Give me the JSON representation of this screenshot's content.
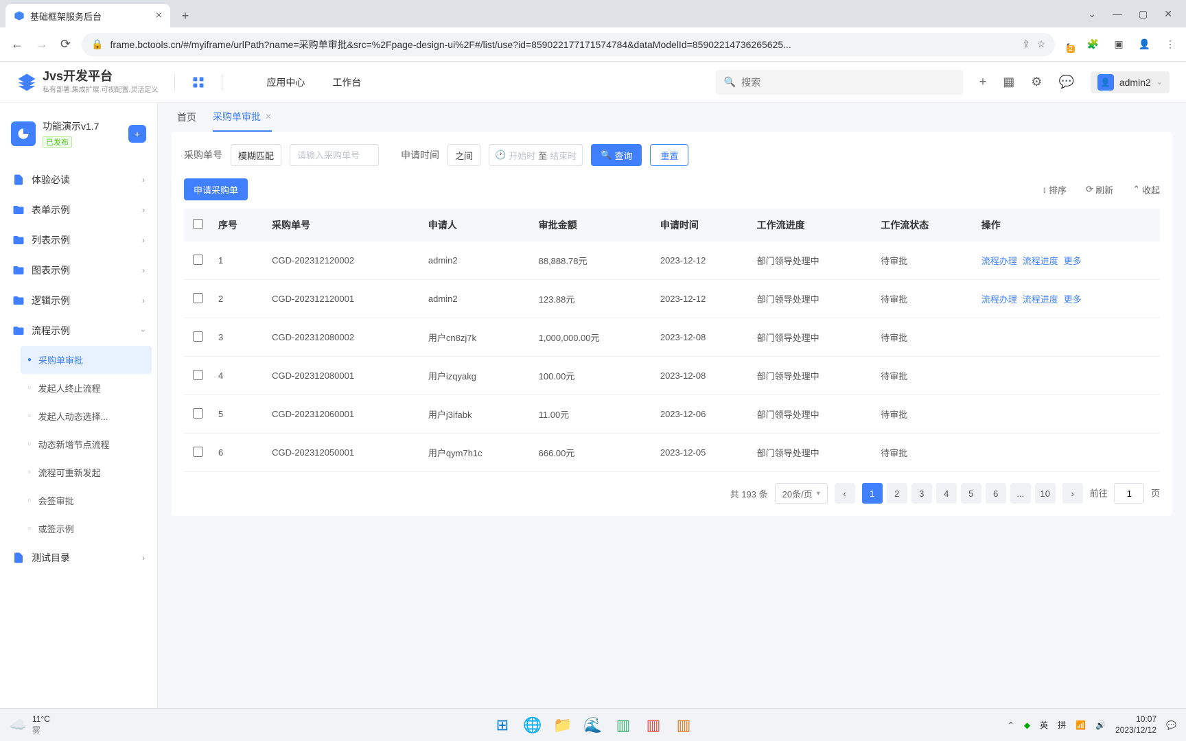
{
  "browser": {
    "tab_title": "基础框架服务后台",
    "url": "frame.bctools.cn/#/myiframe/urlPath?name=采购单审批&src=%2Fpage-design-ui%2F#/list/use?id=859022177171574784&dataModelId=85902214736265625..."
  },
  "header": {
    "logo_title": "Jvs开发平台",
    "logo_subtitle": "私有部署.集成扩展.可视配置.灵活定义",
    "nav_app_center": "应用中心",
    "nav_workspace": "工作台",
    "search_placeholder": "搜索",
    "user_name": "admin2"
  },
  "sidebar": {
    "project_title": "功能演示v1.7",
    "publish_tag": "已发布",
    "menu": [
      {
        "label": "体验必读",
        "icon": "doc"
      },
      {
        "label": "表单示例",
        "icon": "folder"
      },
      {
        "label": "列表示例",
        "icon": "folder"
      },
      {
        "label": "图表示例",
        "icon": "folder"
      },
      {
        "label": "逻辑示例",
        "icon": "folder"
      },
      {
        "label": "流程示例",
        "icon": "folder",
        "open": true,
        "children": [
          {
            "label": "采购单审批",
            "active": true
          },
          {
            "label": "发起人终止流程"
          },
          {
            "label": "发起人动态选择..."
          },
          {
            "label": "动态新增节点流程"
          },
          {
            "label": "流程可重新发起"
          },
          {
            "label": "会签审批"
          },
          {
            "label": "或签示例"
          }
        ]
      },
      {
        "label": "测试目录",
        "icon": "doc"
      }
    ]
  },
  "content": {
    "tabs": [
      {
        "label": "首页"
      },
      {
        "label": "采购单审批",
        "active": true,
        "closable": true
      }
    ],
    "filters": {
      "order_label": "采购单号",
      "match_mode": "模糊匹配",
      "order_placeholder": "请输入采购单号",
      "time_label": "申请时间",
      "between": "之间",
      "start_placeholder": "开始时",
      "to": "至",
      "end_placeholder": "结束时",
      "search_btn": "查询",
      "reset_btn": "重置"
    },
    "action_button": "申请采购单",
    "toolbar_right": {
      "sort": "排序",
      "refresh": "刷新",
      "collapse": "收起"
    },
    "columns": [
      "序号",
      "采购单号",
      "申请人",
      "审批金额",
      "申请时间",
      "工作流进度",
      "工作流状态",
      "操作"
    ],
    "op_links": {
      "process": "流程办理",
      "progress": "流程进度",
      "more": "更多"
    },
    "rows": [
      {
        "idx": "1",
        "no": "CGD-202312120002",
        "user": "admin2",
        "amount": "88,888.78元",
        "date": "2023-12-12",
        "progress": "部门领导处理中",
        "status": "待审批",
        "ops": true
      },
      {
        "idx": "2",
        "no": "CGD-202312120001",
        "user": "admin2",
        "amount": "123.88元",
        "date": "2023-12-12",
        "progress": "部门领导处理中",
        "status": "待审批",
        "ops": true
      },
      {
        "idx": "3",
        "no": "CGD-202312080002",
        "user": "用户cn8zj7k",
        "amount": "1,000,000.00元",
        "date": "2023-12-08",
        "progress": "部门领导处理中",
        "status": "待审批"
      },
      {
        "idx": "4",
        "no": "CGD-202312080001",
        "user": "用户izqyakg",
        "amount": "100.00元",
        "date": "2023-12-08",
        "progress": "部门领导处理中",
        "status": "待审批"
      },
      {
        "idx": "5",
        "no": "CGD-202312060001",
        "user": "用户j3ifabk",
        "amount": "11.00元",
        "date": "2023-12-06",
        "progress": "部门领导处理中",
        "status": "待审批"
      },
      {
        "idx": "6",
        "no": "CGD-202312050001",
        "user": "用户qym7h1c",
        "amount": "666.00元",
        "date": "2023-12-05",
        "progress": "部门领导处理中",
        "status": "待审批"
      }
    ],
    "pagination": {
      "total_text": "共 193 条",
      "page_size": "20条/页",
      "pages": [
        "1",
        "2",
        "3",
        "4",
        "5",
        "6",
        "...",
        "10"
      ],
      "current": "1",
      "goto_label": "前往",
      "goto_value": "1",
      "page_suffix": "页"
    }
  },
  "taskbar": {
    "temp": "11°C",
    "weather": "雾",
    "ime_lang": "英",
    "ime_input": "拼",
    "time": "10:07",
    "date": "2023/12/12"
  }
}
